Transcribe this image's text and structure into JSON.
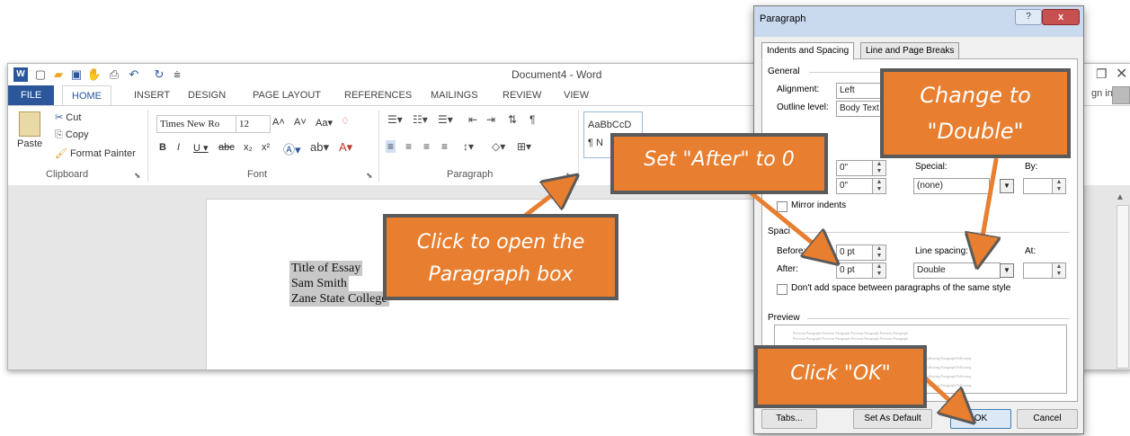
{
  "word": {
    "doc_title": "Document4 - Word",
    "tabs": [
      "FILE",
      "HOME",
      "INSERT",
      "DESIGN",
      "PAGE LAYOUT",
      "REFERENCES",
      "MAILINGS",
      "REVIEW",
      "VIEW"
    ],
    "sign_in": "gn in",
    "clipboard": {
      "paste": "Paste",
      "cut": "Cut",
      "copy": "Copy",
      "format_painter": "Format Painter",
      "label": "Clipboard"
    },
    "font": {
      "name": "Times New Ro",
      "size": "12",
      "label": "Font"
    },
    "paragraph_label": "Paragraph",
    "styles": {
      "sample1": "AaBbCcD",
      "sample2": "¶ N"
    },
    "document_lines": [
      "Title of Essay",
      "Sam Smith",
      "Zane State College"
    ]
  },
  "dialog": {
    "title": "Paragraph",
    "help": "?",
    "close": "x",
    "tabs": [
      "Indents and Spacing",
      "Line and Page Breaks"
    ],
    "general": {
      "section": "General",
      "alignment_label": "Alignment:",
      "alignment_value": "Left",
      "outline_label": "Outline level:",
      "outline_value": "Body Text"
    },
    "indentation": {
      "left_value": "0\"",
      "right_value": "0\"",
      "special_label": "Special:",
      "special_value": "(none)",
      "by_label": "By:",
      "mirror_label": "Mirror indents"
    },
    "spacing": {
      "section": "Spaci",
      "before_label": "Before:",
      "before_value": "0 pt",
      "after_label": "After:",
      "after_value": "0 pt",
      "line_spacing_label": "Line spacing:",
      "line_spacing_value": "Double",
      "at_label": "At:",
      "dont_add_label": "Don't add space between paragraphs of the same style"
    },
    "preview": {
      "section": "Preview",
      "previous_text": "Previous Paragraph Previous Paragraph Previous Paragraph Previous Paragraph",
      "following_text": "Paragraph Following Paragraph Following"
    },
    "buttons": {
      "tabs": "Tabs...",
      "set_default": "Set As Default",
      "ok": "OK",
      "cancel": "Cancel"
    }
  },
  "callouts": {
    "paragraph": "Click to open the Paragraph box",
    "after": "Set \"After\" to 0",
    "double": "Change to \"Double\"",
    "ok": "Click \"OK\""
  },
  "colors": {
    "callout_fill": "#e87e2f",
    "callout_border": "#5a5a5a",
    "word_blue": "#2b579a"
  }
}
